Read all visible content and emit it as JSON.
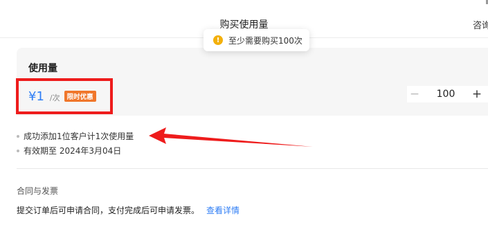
{
  "header": {
    "title": "购买使用量",
    "consult_label": "咨询"
  },
  "toast": {
    "icon": "warning-icon",
    "icon_glyph": "!",
    "message": "至少需要购买100次"
  },
  "usage": {
    "title": "使用量",
    "price": "¥1",
    "unit": "/次",
    "badge": "限时优惠",
    "quantity": "100",
    "decrease_glyph": "−",
    "increase_glyph": "+",
    "notes": [
      "成功添加1位客户计1次使用量",
      "有效期至 2024年3月04日"
    ]
  },
  "contract": {
    "title": "合同与发票",
    "text": "提交订单后可申请合同，支付完成后可申请发票。",
    "link": "查看详情"
  },
  "colors": {
    "accent": "#2f7ef5",
    "badge": "#f0762a",
    "highlight": "#ee1c1c",
    "toast_icon": "#f3b00b"
  }
}
